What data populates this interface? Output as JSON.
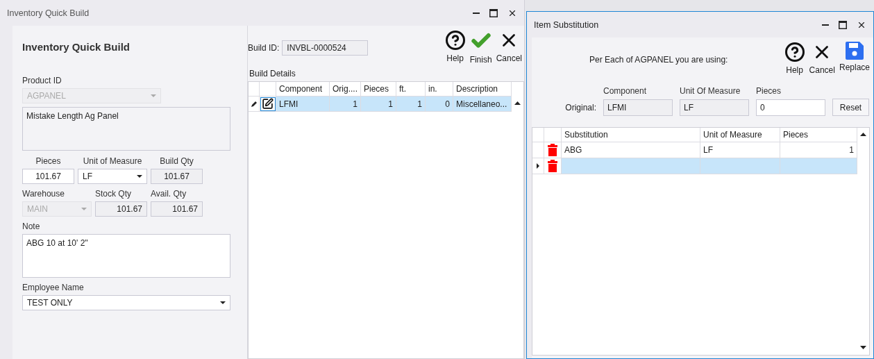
{
  "main_window": {
    "title": "Inventory Quick Build",
    "heading": "Inventory Quick Build",
    "product": {
      "label": "Product ID",
      "value": "AGPANEL",
      "disabled": true
    },
    "description": {
      "value": "Mistake Length Ag Panel"
    },
    "qty_fields": [
      {
        "label": "Pieces",
        "value": "101.67",
        "kind": "input",
        "disabled": false
      },
      {
        "label": "Unit of Measure",
        "value": "LF",
        "kind": "dropdown",
        "disabled": false
      },
      {
        "label": "Build Qty",
        "value": "101.67",
        "kind": "readonly",
        "disabled": false
      }
    ],
    "stock_fields": [
      {
        "label": "Warehouse",
        "value": "MAIN",
        "kind": "dropdown",
        "disabled": true
      },
      {
        "label": "Stock Qty",
        "value": "101.67",
        "kind": "readonly",
        "disabled": false
      },
      {
        "label": "Avail. Qty",
        "value": "101.67",
        "kind": "readonly",
        "disabled": false
      }
    ],
    "note": {
      "label": "Note",
      "value": "ABG 10 at 10' 2\""
    },
    "employee": {
      "label": "Employee Name",
      "value": "TEST ONLY"
    },
    "build_id": {
      "label": "Build ID:",
      "value": "INVBL-0000524"
    },
    "toolbar": [
      {
        "label": "Help",
        "kind": "help"
      },
      {
        "label": "Finish",
        "kind": "finish"
      },
      {
        "label": "Cancel",
        "kind": "cancel"
      }
    ],
    "grid": {
      "title": "Build Details",
      "columns": [
        {
          "label": "Component",
          "kind": "text"
        },
        {
          "label": "Orig....",
          "kind": "number"
        },
        {
          "label": "Pieces",
          "kind": "number"
        },
        {
          "label": "ft.",
          "kind": "number"
        },
        {
          "label": "in.",
          "kind": "number"
        },
        {
          "label": "Description",
          "kind": "text"
        }
      ],
      "rows": [
        {
          "selected": true,
          "kind": "edit",
          "cells": [
            "LFMI",
            "1",
            "1",
            "1",
            "0",
            "Miscellaneo..."
          ]
        }
      ]
    }
  },
  "substitution_dialog": {
    "title": "Item Substitution",
    "prompt": "Per Each of AGPANEL you are using:",
    "toolbar": [
      {
        "label": "Help",
        "kind": "help"
      },
      {
        "label": "Cancel",
        "kind": "cancel"
      },
      {
        "label": "Replace",
        "kind": "save"
      }
    ],
    "original_label": "Original:",
    "original_fields": [
      {
        "label": "Component",
        "value": "LFMI",
        "kind": "readonly"
      },
      {
        "label": "Unit Of Measure",
        "value": "LF",
        "kind": "readonly"
      },
      {
        "label": "Pieces",
        "value": "0",
        "kind": "input"
      }
    ],
    "reset_button": "Reset",
    "grid": {
      "columns": [
        {
          "label": "Substitution",
          "kind": "text"
        },
        {
          "label": "Unit of Measure",
          "kind": "text"
        },
        {
          "label": "Pieces",
          "kind": "number"
        }
      ],
      "rows": [
        {
          "selected": false,
          "kind": "plain",
          "cells": [
            "ABG",
            "LF",
            "1"
          ]
        },
        {
          "selected": true,
          "kind": "current",
          "cells": null
        }
      ]
    }
  }
}
